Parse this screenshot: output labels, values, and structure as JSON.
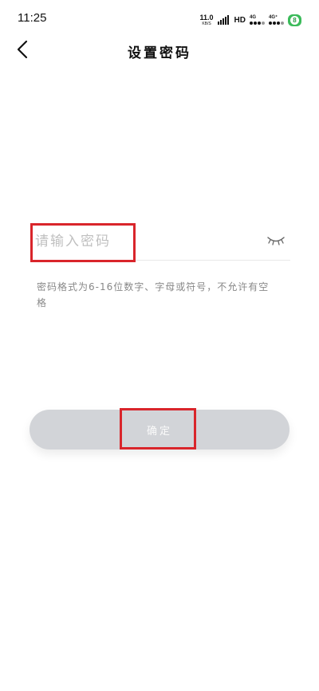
{
  "status_bar": {
    "time": "11:25",
    "net_speed_value": "11.0",
    "net_speed_unit": "KB/S",
    "hd_label": "HD",
    "sim1_label": "4G",
    "sim2_label": "4G⁺",
    "battery_label": "8"
  },
  "header": {
    "title": "设置密码",
    "back_icon": "chevron-left-icon"
  },
  "password": {
    "value": "",
    "placeholder": "请输入密码",
    "visibility_icon": "eye-closed-icon"
  },
  "hint": "密码格式为6-16位数字、字母或符号，不允许有空格",
  "confirm": {
    "label": "确定",
    "state": "disabled"
  },
  "colors": {
    "highlight": "#d9252b",
    "button_disabled": "#d2d4d8",
    "placeholder": "#c0c0c0",
    "hint": "#888888"
  }
}
